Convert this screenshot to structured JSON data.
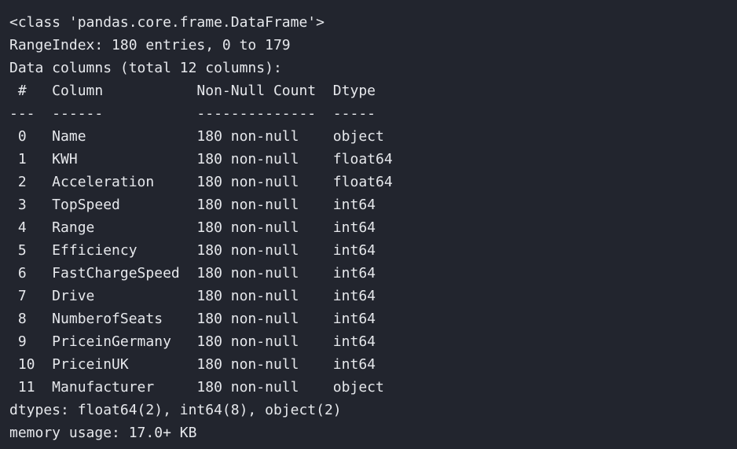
{
  "theme": {
    "background": "#22252e",
    "foreground": "#e6e8ec"
  },
  "output": {
    "kind": "pandas-dataframe-info",
    "class_line": "<class 'pandas.core.frame.DataFrame'>",
    "range_index_line": "RangeIndex: 180 entries, 0 to 179",
    "data_columns_line": "Data columns (total 12 columns):",
    "header_line": " #   Column           Non-Null Count  Dtype  ",
    "separator_line": "---  ------           --------------  -----  ",
    "dtypes_line": "dtypes: float64(2), int64(8), object(2)",
    "memory_line": "memory usage: 17.0+ KB",
    "entries": 180,
    "index_start": 0,
    "index_end": 179,
    "total_columns": 12,
    "memory_usage": "17.0+ KB",
    "column_headers": [
      "#",
      "Column",
      "Non-Null Count",
      "Dtype"
    ],
    "rows": [
      {
        "index": "0",
        "column": "Name",
        "non_null": "180 non-null",
        "dtype": "object",
        "line": " 0   Name             180 non-null    object "
      },
      {
        "index": "1",
        "column": "KWH",
        "non_null": "180 non-null",
        "dtype": "float64",
        "line": " 1   KWH              180 non-null    float64"
      },
      {
        "index": "2",
        "column": "Acceleration",
        "non_null": "180 non-null",
        "dtype": "float64",
        "line": " 2   Acceleration     180 non-null    float64"
      },
      {
        "index": "3",
        "column": "TopSpeed",
        "non_null": "180 non-null",
        "dtype": "int64",
        "line": " 3   TopSpeed         180 non-null    int64  "
      },
      {
        "index": "4",
        "column": "Range",
        "non_null": "180 non-null",
        "dtype": "int64",
        "line": " 4   Range            180 non-null    int64  "
      },
      {
        "index": "5",
        "column": "Efficiency",
        "non_null": "180 non-null",
        "dtype": "int64",
        "line": " 5   Efficiency       180 non-null    int64  "
      },
      {
        "index": "6",
        "column": "FastChargeSpeed",
        "non_null": "180 non-null",
        "dtype": "int64",
        "line": " 6   FastChargeSpeed  180 non-null    int64  "
      },
      {
        "index": "7",
        "column": "Drive",
        "non_null": "180 non-null",
        "dtype": "int64",
        "line": " 7   Drive            180 non-null    int64  "
      },
      {
        "index": "8",
        "column": "NumberofSeats",
        "non_null": "180 non-null",
        "dtype": "int64",
        "line": " 8   NumberofSeats    180 non-null    int64  "
      },
      {
        "index": "9",
        "column": "PriceinGermany",
        "non_null": "180 non-null",
        "dtype": "int64",
        "line": " 9   PriceinGermany   180 non-null    int64  "
      },
      {
        "index": "10",
        "column": "PriceinUK",
        "non_null": "180 non-null",
        "dtype": "int64",
        "line": " 10  PriceinUK        180 non-null    int64  "
      },
      {
        "index": "11",
        "column": "Manufacturer",
        "non_null": "180 non-null",
        "dtype": "object",
        "line": " 11  Manufacturer     180 non-null    object "
      }
    ]
  }
}
